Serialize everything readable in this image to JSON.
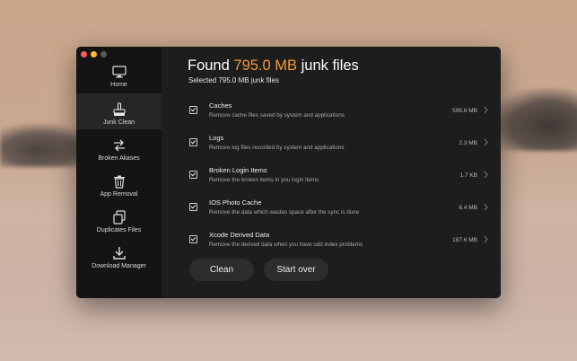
{
  "sidebar": {
    "items": [
      {
        "label": "Home",
        "icon": "monitor-icon"
      },
      {
        "label": "Junk Clean",
        "icon": "broom-icon",
        "active": true
      },
      {
        "label": "Broken Aliases",
        "icon": "shuffle-arrows-icon"
      },
      {
        "label": "App Removal",
        "icon": "trash-icon"
      },
      {
        "label": "Duplicates Files",
        "icon": "duplicate-files-icon"
      },
      {
        "label": "Download Manager",
        "icon": "download-icon"
      }
    ]
  },
  "header": {
    "title_prefix": "Found",
    "title_amount": "795.0 MB",
    "title_suffix": "junk files",
    "selected": "Selected 795.0 MB junk files"
  },
  "items": [
    {
      "title": "Caches",
      "description": "Remove cache files saved by system and applications",
      "size": "596.8 MB",
      "checked": true
    },
    {
      "title": "Logs",
      "description": "Remove log files recorded by system and applications",
      "size": "2.3 MB",
      "checked": true
    },
    {
      "title": "Broken Login Items",
      "description": "Remove the broken items in you login items",
      "size": "1.7 KB",
      "checked": true
    },
    {
      "title": "IOS Photo Cache",
      "description": "Remove the data which wastes space after the sync is done",
      "size": "8.4 MB",
      "checked": true
    },
    {
      "title": "Xcode Derived Data",
      "description": "Remove the derived data when you have odd index problems",
      "size": "187.6 MB",
      "checked": true
    }
  ],
  "buttons": {
    "clean": "Clean",
    "start_over": "Start over"
  },
  "colors": {
    "accent": "#f39a34"
  }
}
